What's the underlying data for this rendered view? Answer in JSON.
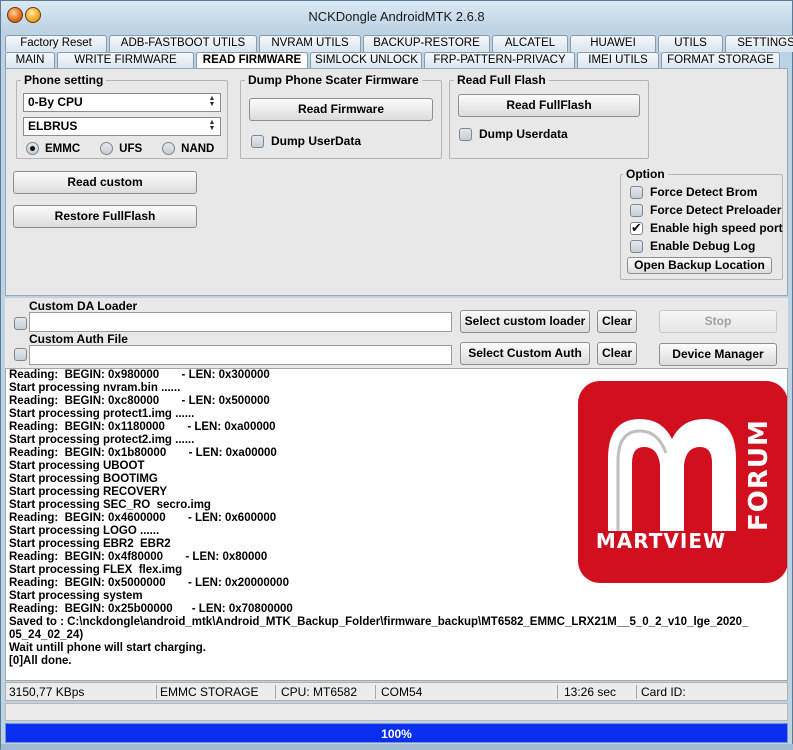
{
  "window": {
    "title": "NCKDongle AndroidMTK 2.6.8"
  },
  "tabs_row1": [
    {
      "label": "Factory Reset",
      "w": 102
    },
    {
      "label": "ADB-FASTBOOT UTILS",
      "w": 148
    },
    {
      "label": "NVRAM UTILS",
      "w": 102
    },
    {
      "label": "BACKUP-RESTORE",
      "w": 127
    },
    {
      "label": "ALCATEL",
      "w": 76
    },
    {
      "label": "HUAWEI",
      "w": 86
    },
    {
      "label": "UTILS",
      "w": 65
    },
    {
      "label": "SETTINGS",
      "w": 82
    }
  ],
  "tabs_row2": [
    {
      "label": "MAIN",
      "w": 50,
      "active": false
    },
    {
      "label": "WRITE FIRMWARE",
      "w": 137,
      "active": false
    },
    {
      "label": "READ FIRMWARE",
      "w": 112,
      "active": true
    },
    {
      "label": "SIMLOCK UNLOCK",
      "w": 112,
      "active": false
    },
    {
      "label": "FRP-PATTERN-PRIVACY",
      "w": 151,
      "active": false
    },
    {
      "label": "IMEI UTILS",
      "w": 82,
      "active": false
    },
    {
      "label": "FORMAT STORAGE",
      "w": 119,
      "active": false
    }
  ],
  "phone_setting": {
    "legend": "Phone setting",
    "cpu_value": "0-By CPU",
    "model_value": "ELBRUS",
    "storage_options": [
      "EMMC",
      "UFS",
      "NAND"
    ],
    "storage_selected": "EMMC"
  },
  "dump_scatter": {
    "legend": "Dump  Phone Scater Firmware",
    "read_button": "Read  Firmware",
    "dump_userdata": "Dump UserData"
  },
  "read_full_flash": {
    "legend": "Read Full Flash",
    "read_button": "Read FullFlash",
    "dump_userdata": "Dump Userdata"
  },
  "actions": {
    "read_custom": "Read custom",
    "restore_fullflash": "Restore FullFlash"
  },
  "options": {
    "legend": "Option",
    "items": [
      {
        "label": "Force Detect Brom",
        "checked": false
      },
      {
        "label": "Force Detect Preloader",
        "checked": false
      },
      {
        "label": "Enable high speed port",
        "checked": true
      },
      {
        "label": "Enable Debug Log",
        "checked": false
      }
    ],
    "open_backup": "Open Backup Location"
  },
  "custom": {
    "da_label": "Custom DA Loader",
    "auth_label": "Custom Auth File",
    "select_loader": "Select custom loader",
    "select_auth": "Select Custom Auth",
    "clear": "Clear",
    "stop": "Stop",
    "device_manager": "Device Manager"
  },
  "log_lines": [
    "Reading:  BEGIN: 0x980000       - LEN: 0x300000",
    "Start processing nvram.bin ......",
    "Reading:  BEGIN: 0xc80000       - LEN: 0x500000",
    "Start processing protect1.img ......",
    "Reading:  BEGIN: 0x1180000       - LEN: 0xa00000",
    "Start processing protect2.img ......",
    "Reading:  BEGIN: 0x1b80000       - LEN: 0xa00000",
    "Start processing UBOOT",
    "Start processing BOOTIMG",
    "Start processing RECOVERY",
    "Start processing SEC_RO  secro.img",
    "Reading:  BEGIN: 0x4600000       - LEN: 0x600000",
    "Start processing LOGO ......",
    "Start processing EBR2  EBR2",
    "Reading:  BEGIN: 0x4f80000       - LEN: 0x80000",
    "Start processing FLEX  flex.img",
    "Reading:  BEGIN: 0x5000000       - LEN: 0x20000000",
    "Start processing system",
    "Reading:  BEGIN: 0x25b00000      - LEN: 0x70800000",
    "Saved to : C:\\nckdongle\\android_mtk\\Android_MTK_Backup_Folder\\firmware_backup\\MT6582_EMMC_LRX21M__5_0_2_v10_lge_2020_",
    "05_24_02_24)",
    "Wait untill phone will start charging.",
    "[0]All done."
  ],
  "logo": {
    "brand": "MARTVIEW",
    "tag": "FORUM",
    "bg_color": "#d10f1f"
  },
  "status": {
    "speed": "3150,77 KBps",
    "storage": "EMMC STORAGE",
    "cpu": "CPU: MT6582",
    "port": "COM54",
    "time": "13:26 sec",
    "card_id": "Card ID:"
  },
  "progress": {
    "value": 100,
    "label": "100%"
  }
}
